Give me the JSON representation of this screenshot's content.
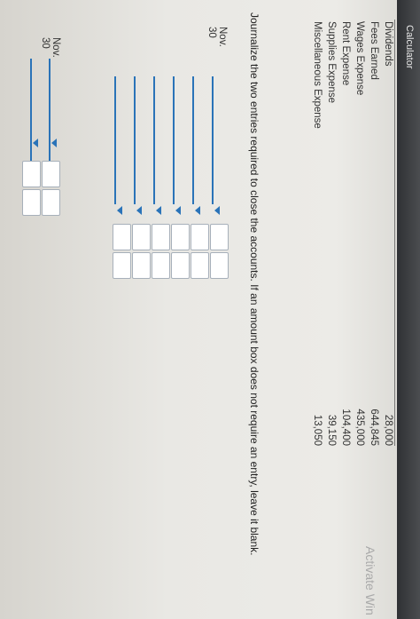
{
  "header": {
    "calculator_label": "Calculator"
  },
  "accounts": [
    {
      "name": "Dividends",
      "amount": "28,000"
    },
    {
      "name": "Fees Earned",
      "amount": "644,845"
    },
    {
      "name": "Wages Expense",
      "amount": "435,000"
    },
    {
      "name": "Rent Expense",
      "amount": "104,400"
    },
    {
      "name": "Supplies Expense",
      "amount": "39,150"
    },
    {
      "name": "Miscellaneous Expense",
      "amount": "13,050"
    }
  ],
  "instructions": "Journalize the two entries required to close the accounts. If an amount box does not require an entry, leave it blank.",
  "journal": {
    "entry1_date": "Nov. 30",
    "entry2_date": "Nov. 30"
  },
  "watermark": "Activate Win",
  "colors": {
    "accent": "#2a73b8",
    "topbar": "#3a3c3f"
  }
}
